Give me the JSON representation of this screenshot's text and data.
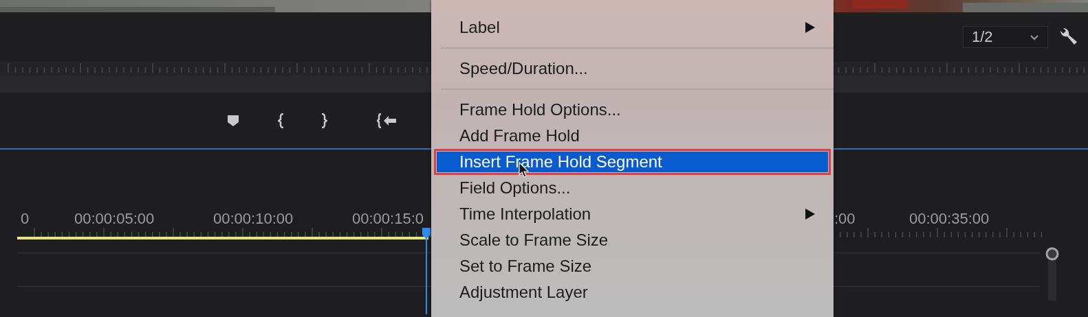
{
  "monitor": {
    "zoom_select": {
      "value": "1/2"
    }
  },
  "timeline": {
    "timecodes": [
      "0",
      "00:00:05:00",
      "00:00:10:00",
      "00:00:15:0",
      ":00",
      "00:00:35:00"
    ]
  },
  "context_menu": {
    "items": [
      {
        "kind": "item",
        "label": "Label",
        "has_submenu": true,
        "selected": false
      },
      {
        "kind": "separator"
      },
      {
        "kind": "item",
        "label": "Speed/Duration...",
        "has_submenu": false,
        "selected": false
      },
      {
        "kind": "separator"
      },
      {
        "kind": "item",
        "label": "Frame Hold Options...",
        "has_submenu": false,
        "selected": false
      },
      {
        "kind": "item",
        "label": "Add Frame Hold",
        "has_submenu": false,
        "selected": false
      },
      {
        "kind": "item",
        "label": "Insert Frame Hold Segment",
        "has_submenu": false,
        "selected": true
      },
      {
        "kind": "item",
        "label": "Field Options...",
        "has_submenu": false,
        "selected": false
      },
      {
        "kind": "item",
        "label": "Time Interpolation",
        "has_submenu": true,
        "selected": false
      },
      {
        "kind": "item",
        "label": "Scale to Frame Size",
        "has_submenu": false,
        "selected": false
      },
      {
        "kind": "item",
        "label": "Set to Frame Size",
        "has_submenu": false,
        "selected": false
      },
      {
        "kind": "item",
        "label": "Adjustment Layer",
        "has_submenu": false,
        "selected": false
      }
    ]
  }
}
